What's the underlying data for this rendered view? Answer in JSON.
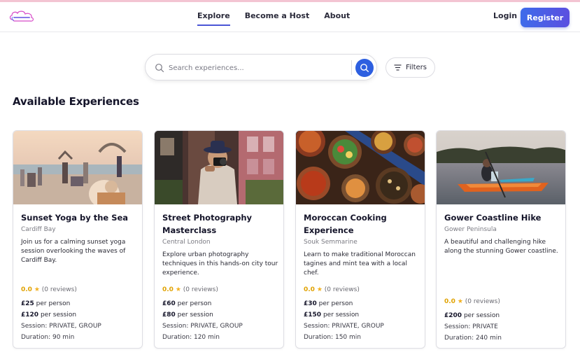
{
  "nav": {
    "logo_alt": "logo",
    "links": [
      "Explore",
      "Become a Host",
      "About"
    ],
    "login": "Login",
    "register": "Register"
  },
  "search": {
    "placeholder": "Search experiences...",
    "value": "",
    "filters_label": "Filters"
  },
  "main": {
    "heading": "Available Experiences",
    "cards": [
      {
        "title": "Sunset Yoga by the Sea",
        "location": "Cardiff Bay",
        "description": "Join us for a calming sunset yoga session overlooking the waves of Cardiff Bay.",
        "rating": "0.0",
        "reviews": "(0 reviews)",
        "price_person": "£25",
        "price_person_suffix": "per person",
        "price_session": "£120",
        "price_session_suffix": "per session",
        "session": "Session: PRIVATE, GROUP",
        "duration": "Duration: 90 min"
      },
      {
        "title": "Street Photography Masterclass",
        "location": "Central London",
        "description": "Explore urban photography techniques in this hands-on city tour experience.",
        "rating": "0.0",
        "reviews": "(0 reviews)",
        "price_person": "£60",
        "price_person_suffix": "per person",
        "price_session": "£80",
        "price_session_suffix": "per session",
        "session": "Session: PRIVATE, GROUP",
        "duration": "Duration: 120 min"
      },
      {
        "title": "Moroccan Cooking Experience",
        "location": "Souk Semmarine",
        "description": "Learn to make traditional Moroccan tagines and mint tea with a local chef.",
        "rating": "0.0",
        "reviews": "(0 reviews)",
        "price_person": "£30",
        "price_person_suffix": "per person",
        "price_session": "£150",
        "price_session_suffix": "per session",
        "session": "Session: PRIVATE, GROUP",
        "duration": "Duration: 150 min"
      },
      {
        "title": "Gower Coastline Hike",
        "location": "Gower Peninsula",
        "description": "A beautiful and challenging hike along the stunning Gower coastline.",
        "rating": "0.0",
        "reviews": "(0 reviews)",
        "price_session": "£200",
        "price_session_suffix": "per session",
        "session": "Session: PRIVATE",
        "duration": "Duration: 240 min"
      }
    ]
  },
  "colors": {
    "accent": "#2d5fe0",
    "star": "#f2b01e"
  },
  "icons": [
    "search-icon",
    "filter-icon",
    "star-icon"
  ]
}
